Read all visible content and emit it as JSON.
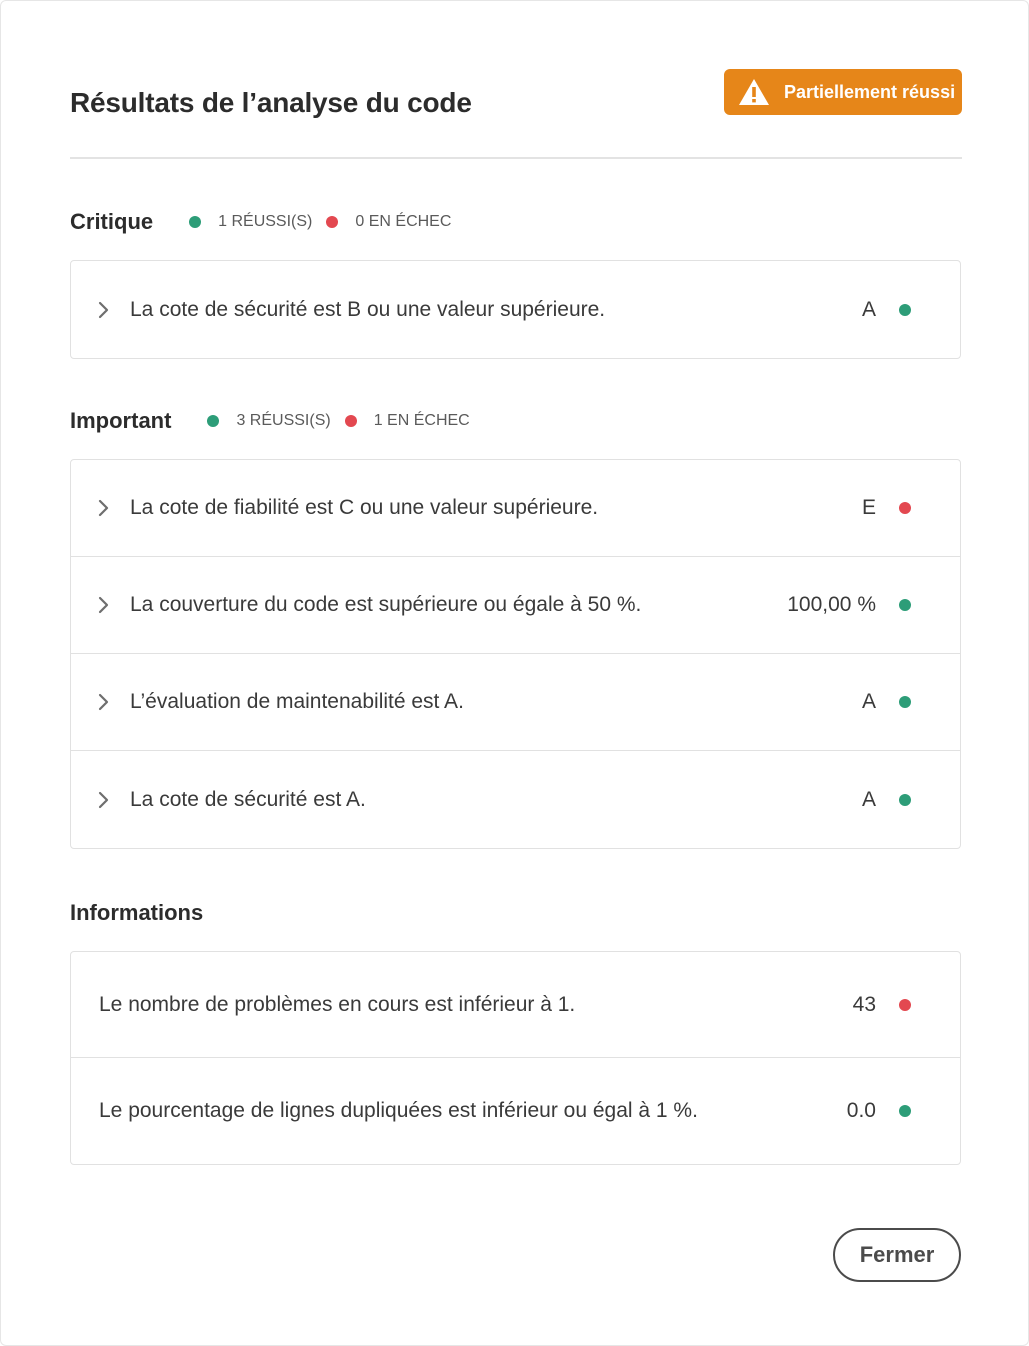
{
  "dialog": {
    "title": "Résultats de l’analyse du code",
    "status_badge": "Partiellement réussi",
    "status_color": "#e68619",
    "close_label": "Fermer"
  },
  "colors": {
    "pass": "#2d9d78",
    "fail": "#e34850"
  },
  "sections": {
    "critical": {
      "title": "Critique",
      "passed": "1 RÉUSSI(S)",
      "failed": "0 EN ÉCHEC",
      "rows": [
        {
          "label": "La cote de sécurité est B ou une valeur supérieure.",
          "value": "A",
          "status": "pass"
        }
      ]
    },
    "important": {
      "title": "Important",
      "passed": "3 RÉUSSI(S)",
      "failed": "1 EN ÉCHEC",
      "rows": [
        {
          "label": "La cote de fiabilité est C ou une valeur supérieure.",
          "value": "E",
          "status": "fail"
        },
        {
          "label": "La couverture du code est supérieure ou égale à 50 %.",
          "value": "100,00 %",
          "status": "pass"
        },
        {
          "label": "L’évaluation de maintenabilité est A.",
          "value": "A",
          "status": "pass"
        },
        {
          "label": "La cote de sécurité est A.",
          "value": "A",
          "status": "pass"
        }
      ]
    },
    "info": {
      "title": "Informations",
      "rows": [
        {
          "label": "Le nombre de problèmes en cours est inférieur à 1.",
          "value": "43",
          "status": "fail"
        },
        {
          "label": "Le pourcentage de lignes dupliquées est inférieur ou égal à 1 %.",
          "value": "0.0",
          "status": "pass"
        }
      ]
    }
  }
}
